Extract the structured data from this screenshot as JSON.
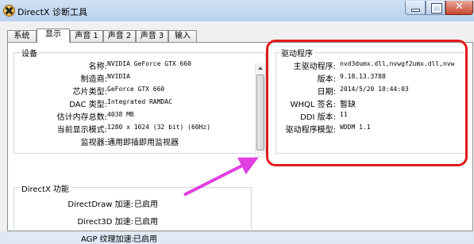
{
  "window": {
    "title": "DirectX 诊断工具"
  },
  "tabs": [
    {
      "label": "系统"
    },
    {
      "label": "显示"
    },
    {
      "label": "声音 1"
    },
    {
      "label": "声音 2"
    },
    {
      "label": "声音 3"
    },
    {
      "label": "输入"
    }
  ],
  "device": {
    "title": "设备",
    "rows": [
      {
        "label": "名称:",
        "value": "NVIDIA GeForce GTX 660"
      },
      {
        "label": "制造商:",
        "value": "NVIDIA"
      },
      {
        "label": "芯片类型:",
        "value": "GeForce GTX 660"
      },
      {
        "label": "DAC 类型:",
        "value": "Integrated RAMDAC"
      },
      {
        "label": "估计内存总数:",
        "value": "4038 MB"
      },
      {
        "label": "当前显示模式:",
        "value": "1280 x 1024 (32 bit) (60Hz)"
      },
      {
        "label": "监视器:",
        "value": "通用即插即用监视器"
      }
    ]
  },
  "driver": {
    "title": "驱动程序",
    "rows": [
      {
        "label": "主驱动程序:",
        "value": "nvd3dumx.dll,nvwgf2umx.dll,nvw"
      },
      {
        "label": "版本:",
        "value": "9.18.13.3788"
      },
      {
        "label": "日期:",
        "value": "2014/5/20 10:44:03"
      },
      {
        "label": "WHQL 签名:",
        "value": "暂缺"
      },
      {
        "label": "DDI 版本:",
        "value": "11"
      },
      {
        "label": "驱动程序模型:",
        "value": "WDDM 1.1"
      }
    ]
  },
  "features": {
    "title": "DirectX 功能",
    "rows": [
      {
        "label": "DirectDraw 加速:",
        "value": "已启用"
      },
      {
        "label": "Direct3D 加速:",
        "value": "已启用"
      },
      {
        "label": "AGP 纹理加速:",
        "value": "已启用"
      }
    ]
  },
  "annotation": {
    "box_color": "#e21b1b",
    "arrow_color": "#e040e0"
  }
}
